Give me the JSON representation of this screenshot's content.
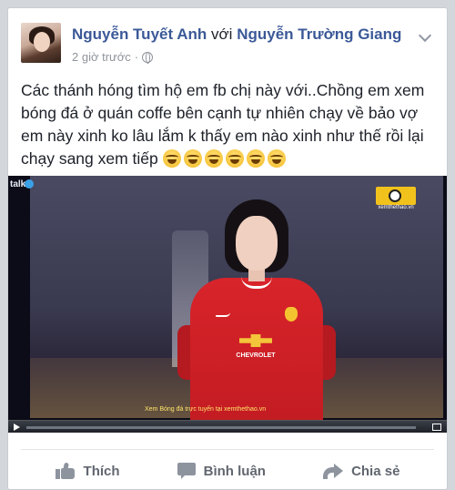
{
  "post": {
    "author": "Nguyễn Tuyết Anh",
    "with_word": "với",
    "tagged": "Nguyễn Trường Giang",
    "time": "2 giờ trước",
    "separator": "·",
    "privacy_icon": "globe-icon",
    "menu_icon": "chevron-down-icon",
    "text": "Các thánh hóng tìm hộ em fb chị này với..Chồng em xem bóng đá ở quán coffe bên cạnh tự nhiên chạy về bảo vợ em này xinh ko lâu lắm k thấy em nào xinh như thế rồi lại chạy sang xem tiếp",
    "emoji_count": 6,
    "emoji_name": "laughing-tears-emoji"
  },
  "video": {
    "watermark": "talk",
    "channel_url": "xemthethao.vn",
    "sponsor": "CHEVROLET",
    "caption": "Xem Bóng đá trực tuyến tại xemthethao.vn"
  },
  "actions": {
    "like": "Thích",
    "comment": "Bình luận",
    "share": "Chia sẻ"
  },
  "colors": {
    "name_blue": "#3b5998",
    "text": "#1d2129",
    "meta_gray": "#90949c",
    "action_gray": "#616770"
  }
}
